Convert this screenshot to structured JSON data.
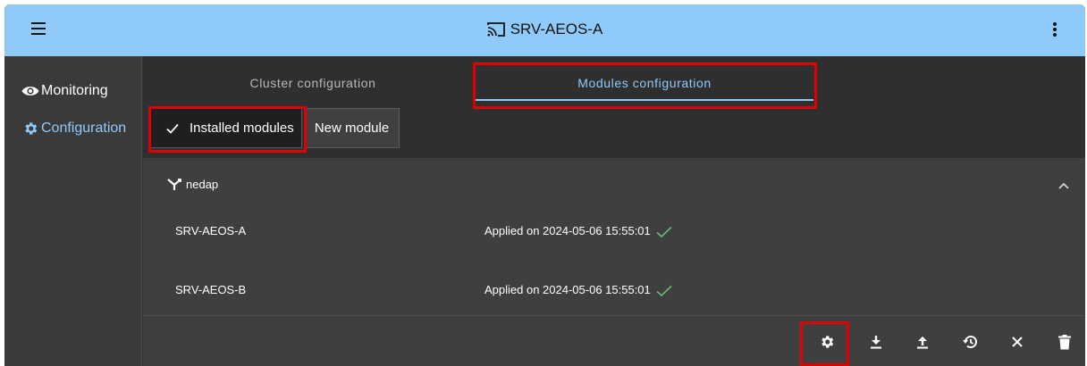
{
  "header": {
    "title": "SRV-AEOS-A",
    "menu_icon": "hamburger-menu-icon",
    "cast_icon": "cast-icon",
    "more_icon": "more-vertical-icon"
  },
  "sidebar": {
    "items": [
      {
        "label": "Monitoring",
        "icon": "eye-icon"
      },
      {
        "label": "Configuration",
        "icon": "gear-icon"
      }
    ]
  },
  "tabs": [
    {
      "label": "Cluster configuration"
    },
    {
      "label": "Modules configuration"
    }
  ],
  "toggles": {
    "installed": "Installed modules",
    "new": "New module"
  },
  "panel": {
    "title": "nedap",
    "rows": [
      {
        "name": "SRV-AEOS-A",
        "status": "Applied on 2024-05-06 15:55:01"
      },
      {
        "name": "SRV-AEOS-B",
        "status": "Applied on 2024-05-06 15:55:01"
      }
    ],
    "actions": [
      "settings-icon",
      "download-icon",
      "upload-icon",
      "history-icon",
      "close-icon",
      "delete-icon"
    ]
  },
  "colors": {
    "accent": "#90caf9",
    "highlight": "#e00000",
    "success": "#66bb6a",
    "background": "#333333"
  }
}
